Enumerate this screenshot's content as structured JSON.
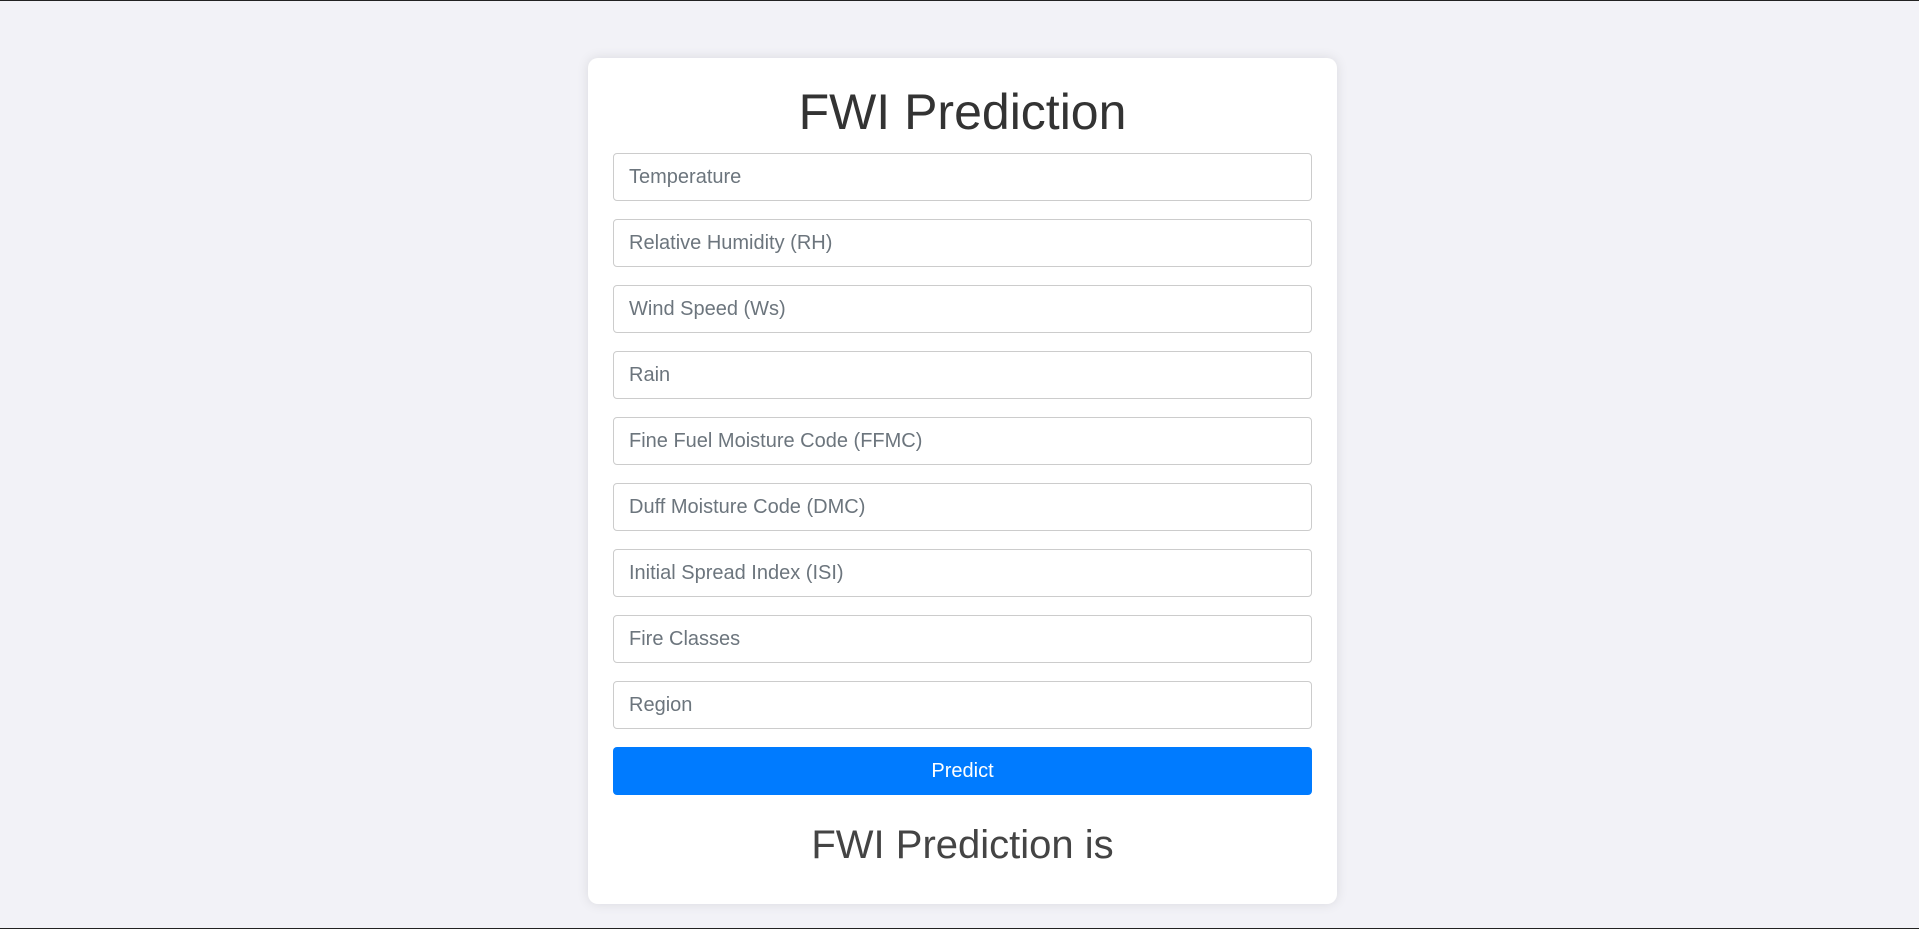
{
  "page": {
    "title": "FWI Prediction",
    "result_text": "FWI Prediction is"
  },
  "form": {
    "fields": [
      {
        "name": "temperature-input",
        "placeholder": "Temperature"
      },
      {
        "name": "relative-humidity-input",
        "placeholder": "Relative Humidity (RH)"
      },
      {
        "name": "wind-speed-input",
        "placeholder": "Wind Speed (Ws)"
      },
      {
        "name": "rain-input",
        "placeholder": "Rain"
      },
      {
        "name": "ffmc-input",
        "placeholder": "Fine Fuel Moisture Code (FFMC)"
      },
      {
        "name": "dmc-input",
        "placeholder": "Duff Moisture Code (DMC)"
      },
      {
        "name": "isi-input",
        "placeholder": "Initial Spread Index (ISI)"
      },
      {
        "name": "fire-classes-input",
        "placeholder": "Fire Classes"
      },
      {
        "name": "region-input",
        "placeholder": "Region"
      }
    ],
    "submit_label": "Predict"
  },
  "colors": {
    "background": "#f2f2f7",
    "card": "#ffffff",
    "accent": "#007bff"
  }
}
